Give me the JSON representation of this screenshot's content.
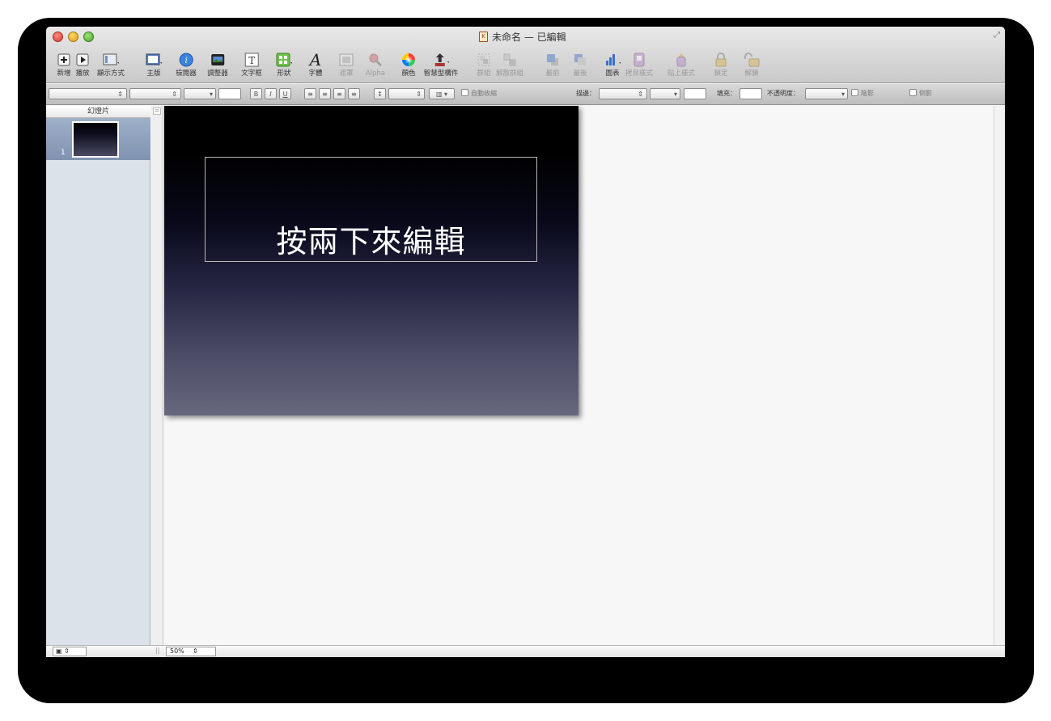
{
  "window": {
    "title": "未命名 — 已編輯"
  },
  "toolbar": {
    "items": [
      {
        "label": "新增",
        "icon": "plus-icon"
      },
      {
        "label": "播放",
        "icon": "play-icon"
      },
      {
        "label": "顯示方式",
        "icon": "view-icon"
      },
      {
        "label": "主版",
        "icon": "master-icon"
      },
      {
        "label": "檢閱器",
        "icon": "info-icon"
      },
      {
        "label": "調整器",
        "icon": "image-adjust-icon"
      },
      {
        "label": "文字框",
        "icon": "textbox-icon"
      },
      {
        "label": "形狀",
        "icon": "shapes-icon"
      },
      {
        "label": "字體",
        "icon": "font-icon"
      },
      {
        "label": "遮罩",
        "icon": "mask-icon"
      },
      {
        "label": "Alpha",
        "icon": "alpha-icon"
      },
      {
        "label": "顏色",
        "icon": "color-wheel-icon"
      },
      {
        "label": "智慧型構件",
        "icon": "smart-build-icon"
      },
      {
        "label": "群組",
        "icon": "group-icon"
      },
      {
        "label": "解散群組",
        "icon": "ungroup-icon"
      },
      {
        "label": "最前",
        "icon": "bring-front-icon"
      },
      {
        "label": "最後",
        "icon": "send-back-icon"
      },
      {
        "label": "圖表",
        "icon": "chart-icon"
      },
      {
        "label": "拷貝樣式",
        "icon": "copy-style-icon"
      },
      {
        "label": "貼上樣式",
        "icon": "paste-style-icon"
      },
      {
        "label": "鎖定",
        "icon": "lock-icon"
      },
      {
        "label": "解鎖",
        "icon": "unlock-icon"
      }
    ]
  },
  "format_bar": {
    "bold": "B",
    "italic": "I",
    "underline": "U",
    "autoshrink": "自動收縮",
    "stroke_label": "描邊：",
    "fill_label": "填充：",
    "opacity_label": "不透明度：",
    "shadow": "陰影",
    "reflection": "倒影"
  },
  "navigator": {
    "header": "幻燈片",
    "slides": [
      {
        "number": "1"
      }
    ]
  },
  "slide": {
    "title_placeholder": "按兩下來編輯"
  },
  "status": {
    "zoom": "50%"
  },
  "colors": {
    "selection": "#8c9fbb",
    "slide_top": "#000000",
    "slide_bottom": "#67677e"
  }
}
